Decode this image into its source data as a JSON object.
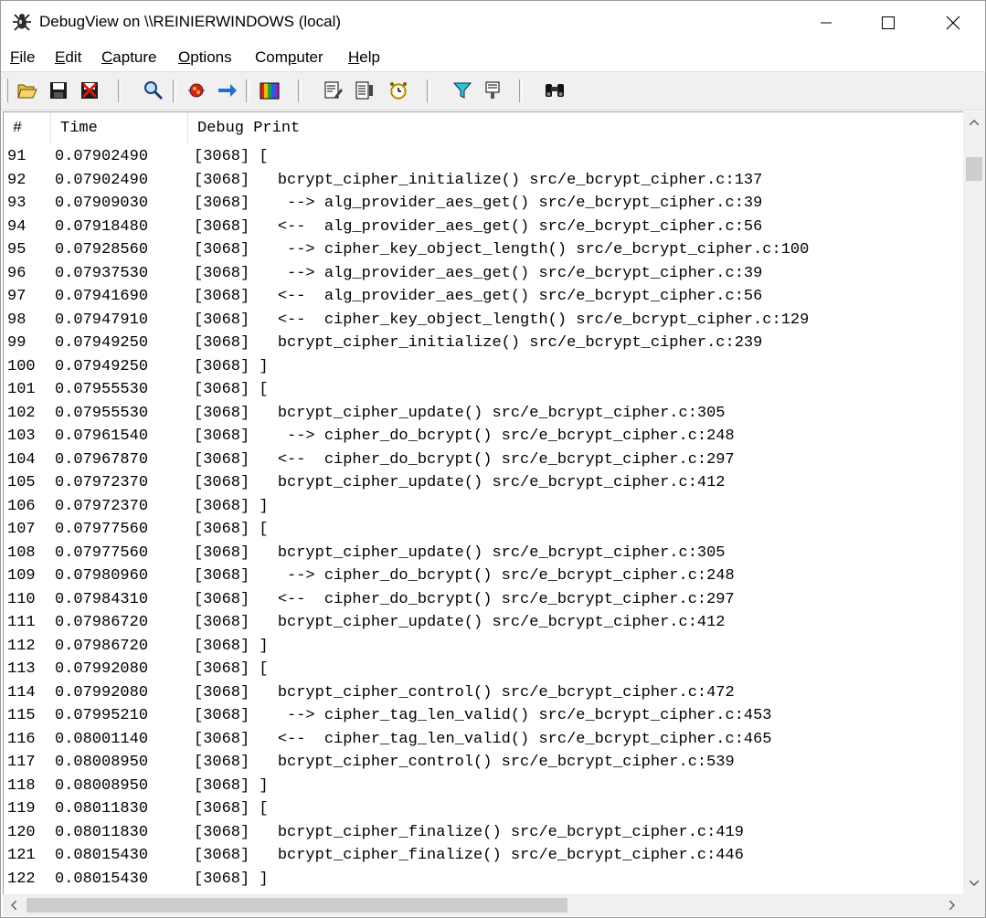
{
  "window": {
    "title": "DebugView on \\\\REINIERWINDOWS (local)"
  },
  "menu": [
    {
      "label": "File",
      "u": "F",
      "rest": "ile"
    },
    {
      "label": "Edit",
      "u": "E",
      "rest": "dit"
    },
    {
      "label": "Capture",
      "u": "C",
      "rest": "apture"
    },
    {
      "label": "Options",
      "u": "O",
      "rest": "ptions"
    },
    {
      "label": "Computer",
      "pre": "Com",
      "u": "p",
      "rest": "uter"
    },
    {
      "label": "Help",
      "u": "H",
      "rest": "elp"
    }
  ],
  "toolbar": {
    "icons": [
      "open-folder-icon",
      "save-icon",
      "clear-display-icon",
      "find-icon",
      "capture-icon",
      "autoscroll-icon",
      "highlight-icon",
      "history-icon",
      "timestamp-icon",
      "clock-icon",
      "filter-icon",
      "filter-clear-icon",
      "binoculars-icon"
    ]
  },
  "columns": {
    "num": "#",
    "time": "Time",
    "msg": "Debug Print"
  },
  "rows": [
    {
      "num": "91",
      "time": "0.07902490",
      "msg": "[3068] ["
    },
    {
      "num": "92",
      "time": "0.07902490",
      "msg": "[3068]   bcrypt_cipher_initialize() src/e_bcrypt_cipher.c:137"
    },
    {
      "num": "93",
      "time": "0.07909030",
      "msg": "[3068]    --> alg_provider_aes_get() src/e_bcrypt_cipher.c:39"
    },
    {
      "num": "94",
      "time": "0.07918480",
      "msg": "[3068]   <--  alg_provider_aes_get() src/e_bcrypt_cipher.c:56"
    },
    {
      "num": "95",
      "time": "0.07928560",
      "msg": "[3068]    --> cipher_key_object_length() src/e_bcrypt_cipher.c:100"
    },
    {
      "num": "96",
      "time": "0.07937530",
      "msg": "[3068]    --> alg_provider_aes_get() src/e_bcrypt_cipher.c:39"
    },
    {
      "num": "97",
      "time": "0.07941690",
      "msg": "[3068]   <--  alg_provider_aes_get() src/e_bcrypt_cipher.c:56"
    },
    {
      "num": "98",
      "time": "0.07947910",
      "msg": "[3068]   <--  cipher_key_object_length() src/e_bcrypt_cipher.c:129"
    },
    {
      "num": "99",
      "time": "0.07949250",
      "msg": "[3068]   bcrypt_cipher_initialize() src/e_bcrypt_cipher.c:239"
    },
    {
      "num": "100",
      "time": "0.07949250",
      "msg": "[3068] ]"
    },
    {
      "num": "101",
      "time": "0.07955530",
      "msg": "[3068] ["
    },
    {
      "num": "102",
      "time": "0.07955530",
      "msg": "[3068]   bcrypt_cipher_update() src/e_bcrypt_cipher.c:305"
    },
    {
      "num": "103",
      "time": "0.07961540",
      "msg": "[3068]    --> cipher_do_bcrypt() src/e_bcrypt_cipher.c:248"
    },
    {
      "num": "104",
      "time": "0.07967870",
      "msg": "[3068]   <--  cipher_do_bcrypt() src/e_bcrypt_cipher.c:297"
    },
    {
      "num": "105",
      "time": "0.07972370",
      "msg": "[3068]   bcrypt_cipher_update() src/e_bcrypt_cipher.c:412"
    },
    {
      "num": "106",
      "time": "0.07972370",
      "msg": "[3068] ]"
    },
    {
      "num": "107",
      "time": "0.07977560",
      "msg": "[3068] ["
    },
    {
      "num": "108",
      "time": "0.07977560",
      "msg": "[3068]   bcrypt_cipher_update() src/e_bcrypt_cipher.c:305"
    },
    {
      "num": "109",
      "time": "0.07980960",
      "msg": "[3068]    --> cipher_do_bcrypt() src/e_bcrypt_cipher.c:248"
    },
    {
      "num": "110",
      "time": "0.07984310",
      "msg": "[3068]   <--  cipher_do_bcrypt() src/e_bcrypt_cipher.c:297"
    },
    {
      "num": "111",
      "time": "0.07986720",
      "msg": "[3068]   bcrypt_cipher_update() src/e_bcrypt_cipher.c:412"
    },
    {
      "num": "112",
      "time": "0.07986720",
      "msg": "[3068] ]"
    },
    {
      "num": "113",
      "time": "0.07992080",
      "msg": "[3068] ["
    },
    {
      "num": "114",
      "time": "0.07992080",
      "msg": "[3068]   bcrypt_cipher_control() src/e_bcrypt_cipher.c:472"
    },
    {
      "num": "115",
      "time": "0.07995210",
      "msg": "[3068]    --> cipher_tag_len_valid() src/e_bcrypt_cipher.c:453"
    },
    {
      "num": "116",
      "time": "0.08001140",
      "msg": "[3068]   <--  cipher_tag_len_valid() src/e_bcrypt_cipher.c:465"
    },
    {
      "num": "117",
      "time": "0.08008950",
      "msg": "[3068]   bcrypt_cipher_control() src/e_bcrypt_cipher.c:539"
    },
    {
      "num": "118",
      "time": "0.08008950",
      "msg": "[3068] ]"
    },
    {
      "num": "119",
      "time": "0.08011830",
      "msg": "[3068] ["
    },
    {
      "num": "120",
      "time": "0.08011830",
      "msg": "[3068]   bcrypt_cipher_finalize() src/e_bcrypt_cipher.c:419"
    },
    {
      "num": "121",
      "time": "0.08015430",
      "msg": "[3068]   bcrypt_cipher_finalize() src/e_bcrypt_cipher.c:446"
    },
    {
      "num": "122",
      "time": "0.08015430",
      "msg": "[3068] ]"
    }
  ]
}
